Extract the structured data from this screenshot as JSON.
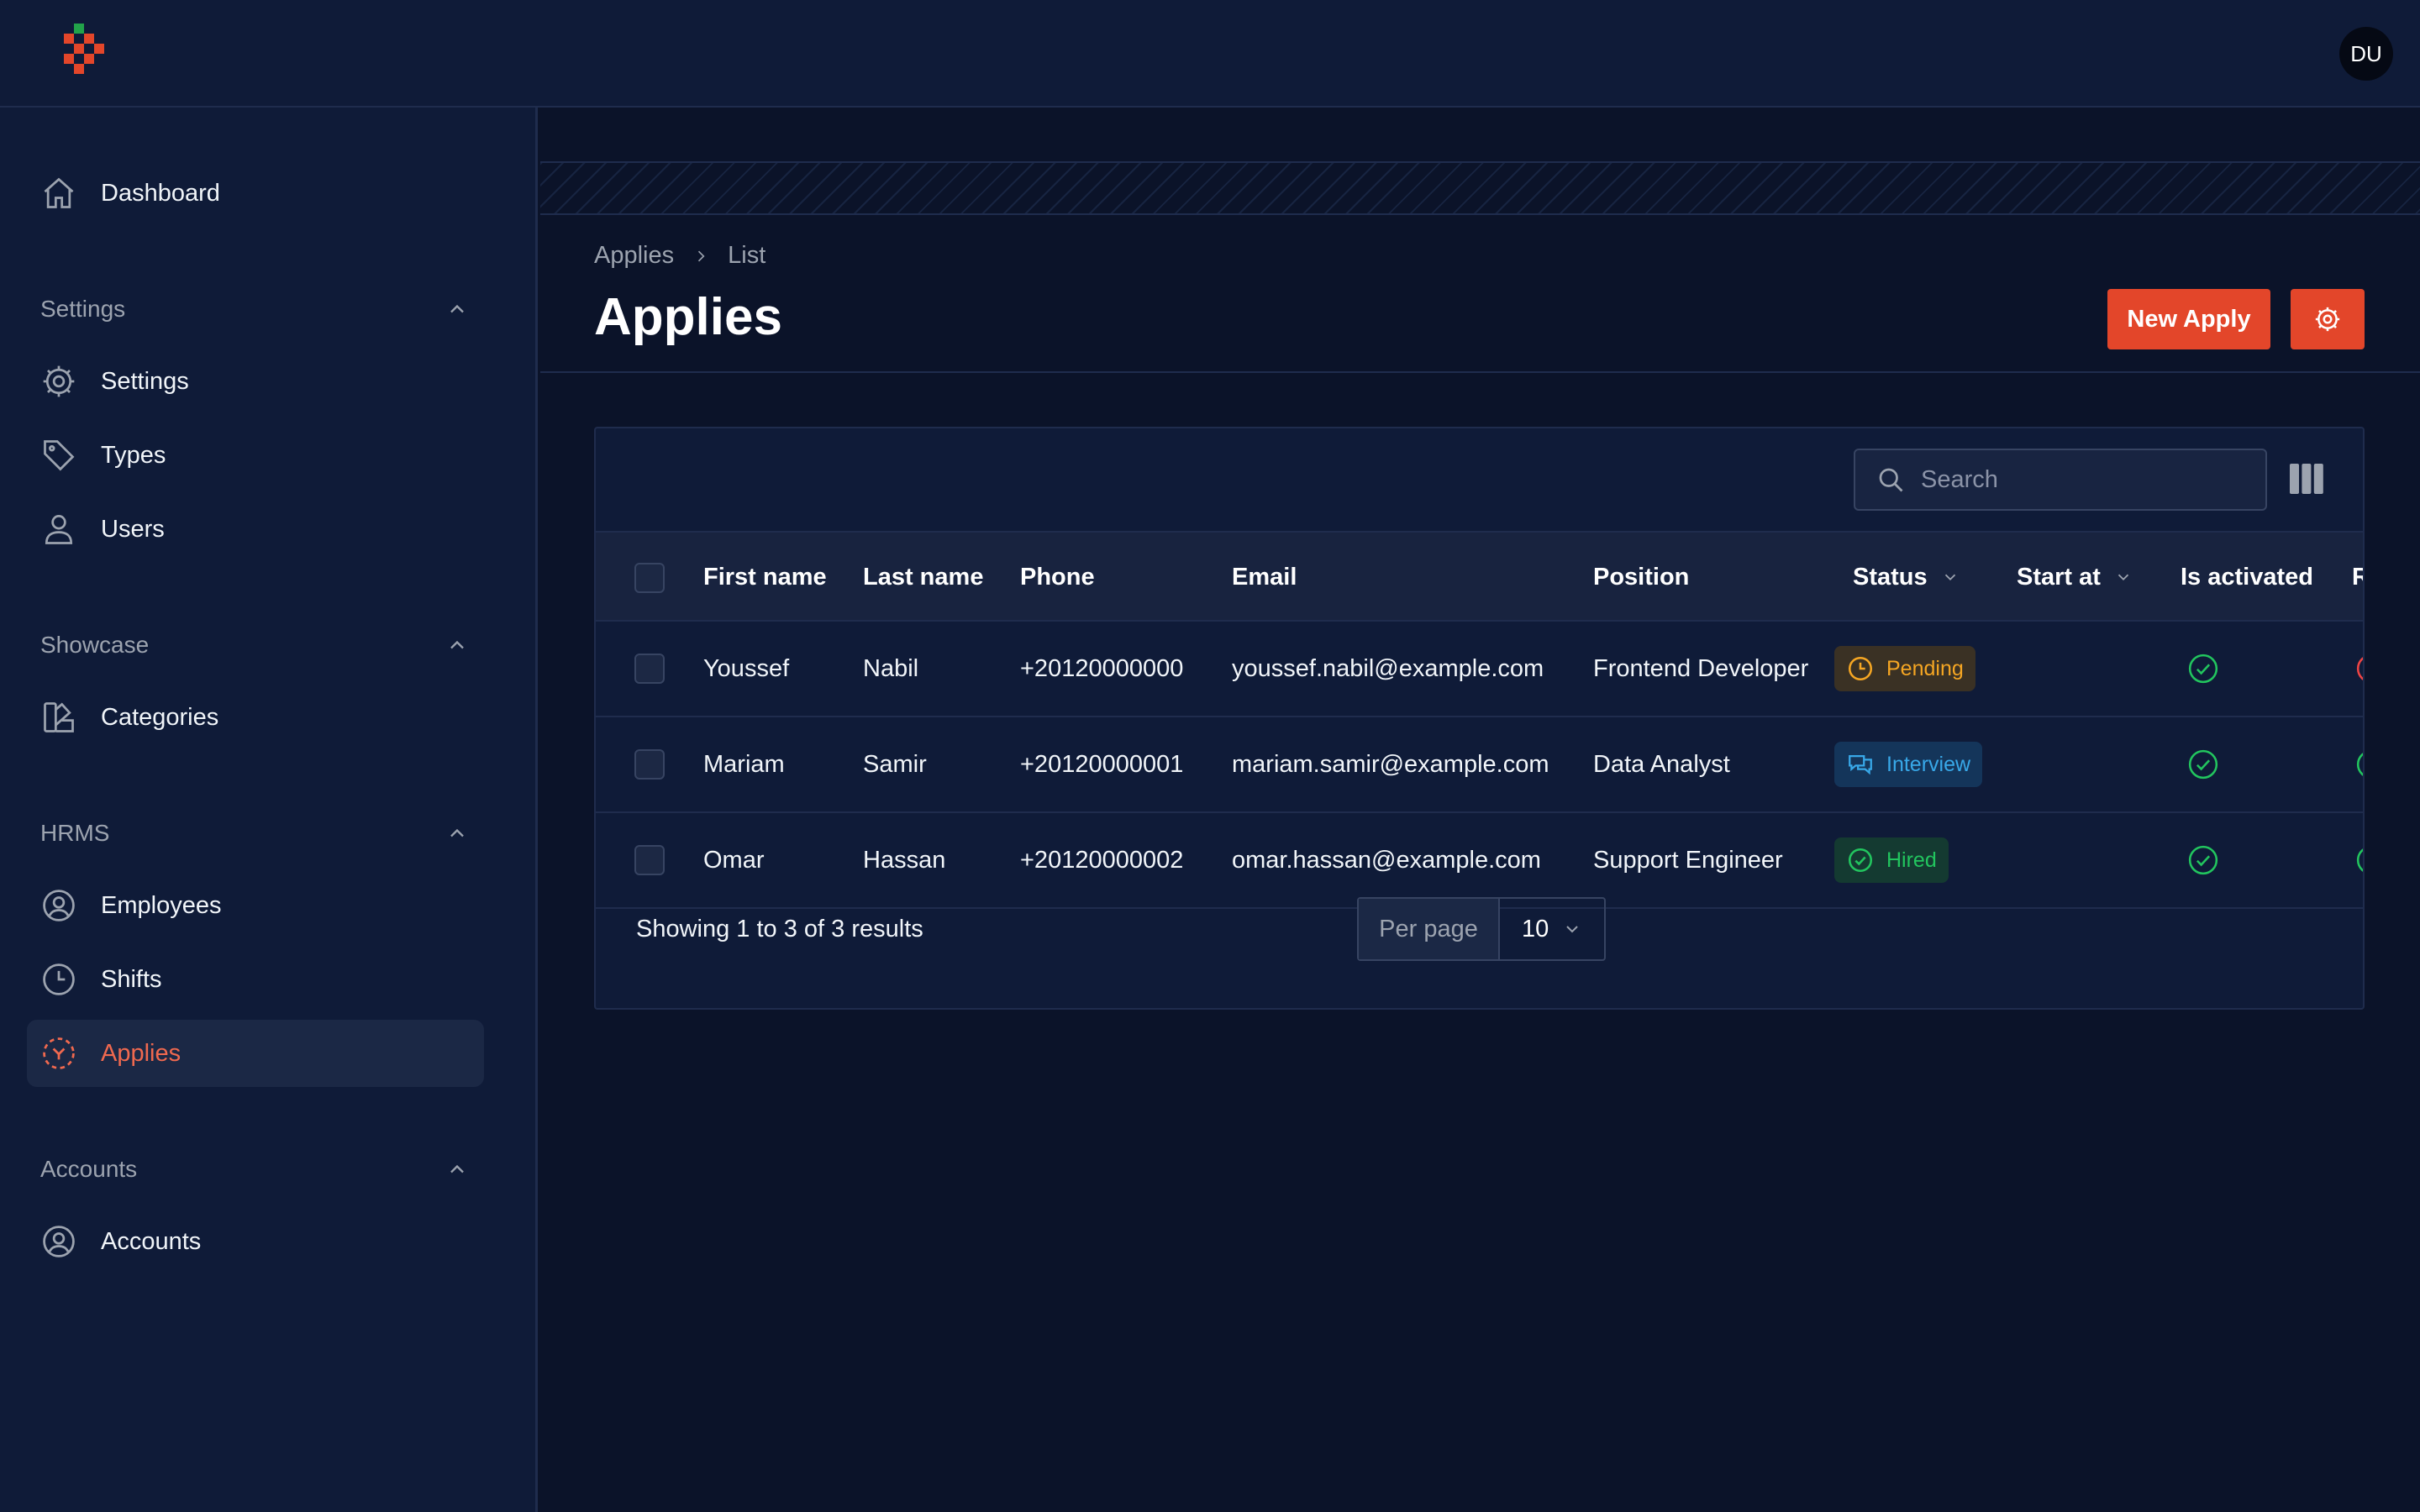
{
  "app": {
    "avatar_initials": "DU",
    "accent_color": "#e3462a"
  },
  "sidebar": {
    "dashboard": {
      "label": "Dashboard",
      "icon": "home-icon"
    },
    "groups": [
      {
        "label": "Settings",
        "items": [
          {
            "label": "Settings",
            "icon": "gear-icon"
          },
          {
            "label": "Types",
            "icon": "tag-icon"
          },
          {
            "label": "Users",
            "icon": "user-icon"
          }
        ]
      },
      {
        "label": "Showcase",
        "items": [
          {
            "label": "Categories",
            "icon": "swatch-icon"
          }
        ]
      },
      {
        "label": "HRMS",
        "items": [
          {
            "label": "Employees",
            "icon": "user-circle-icon"
          },
          {
            "label": "Shifts",
            "icon": "clock-icon"
          },
          {
            "label": "Applies",
            "icon": "viewfinder-icon",
            "active": true
          }
        ]
      },
      {
        "label": "Accounts",
        "items": [
          {
            "label": "Accounts",
            "icon": "user-circle-icon"
          }
        ]
      }
    ]
  },
  "header": {
    "breadcrumb": [
      "Applies",
      "List"
    ],
    "title": "Applies",
    "new_button": "New Apply"
  },
  "table": {
    "search_placeholder": "Search",
    "columns": [
      "First name",
      "Last name",
      "Phone",
      "Email",
      "Position",
      "Status",
      "Start at",
      "Is activated",
      "R"
    ],
    "rows": [
      {
        "first_name": "Youssef",
        "last_name": "Nabil",
        "phone": "+20120000000",
        "email": "youssef.nabil@example.com",
        "position": "Frontend Developer",
        "status": "Pending",
        "is_activated": true,
        "r": false
      },
      {
        "first_name": "Mariam",
        "last_name": "Samir",
        "phone": "+20120000001",
        "email": "mariam.samir@example.com",
        "position": "Data Analyst",
        "status": "Interview",
        "is_activated": true,
        "r": true
      },
      {
        "first_name": "Omar",
        "last_name": "Hassan",
        "phone": "+20120000002",
        "email": "omar.hassan@example.com",
        "position": "Support Engineer",
        "status": "Hired",
        "is_activated": true,
        "r": true
      }
    ],
    "footer": {
      "summary": "Showing 1 to 3 of 3 results",
      "per_page_label": "Per page",
      "per_page_value": "10"
    },
    "status_colors": {
      "Pending": "#f5a623",
      "Interview": "#38a8e8",
      "Hired": "#22c55e"
    }
  }
}
